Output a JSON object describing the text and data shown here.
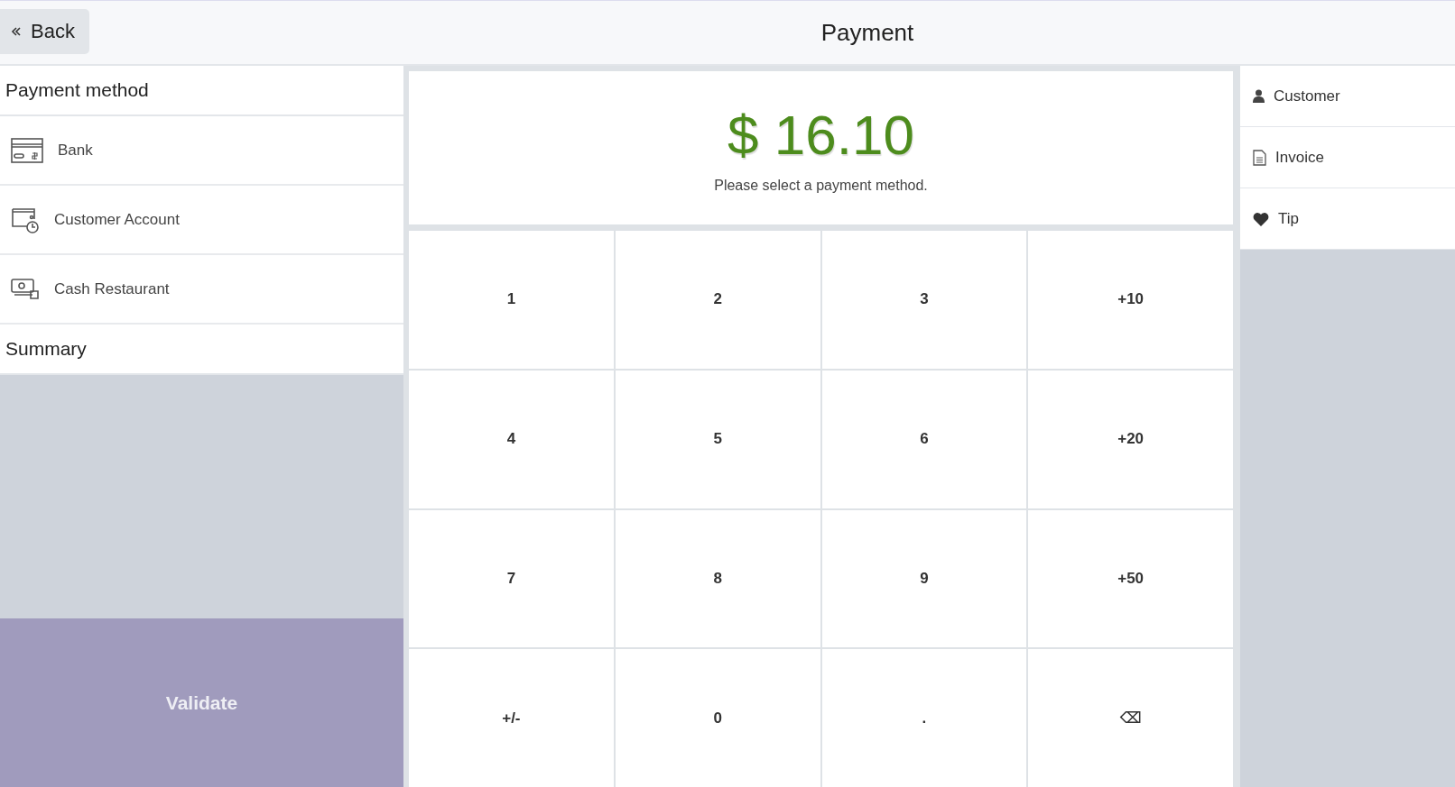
{
  "header": {
    "back_button": "Back",
    "title": "Payment"
  },
  "payment_methods": {
    "title": "Payment method",
    "items": [
      {
        "label": "Bank",
        "kind": "bank"
      },
      {
        "label": "Customer Account",
        "kind": "account"
      },
      {
        "label": "Cash Restaurant",
        "kind": "cash"
      }
    ]
  },
  "summary": {
    "title": "Summary"
  },
  "validate_button": {
    "label": "Validate",
    "disabled": true
  },
  "amount": {
    "total": "$ 16.10",
    "message": "Please select a payment method."
  },
  "numpad": [
    "1",
    "2",
    "3",
    "+10",
    "4",
    "5",
    "6",
    "+20",
    "7",
    "8",
    "9",
    "+50",
    "+/-",
    "0",
    ".",
    "⌫"
  ],
  "side_actions": [
    {
      "label": "Customer",
      "kind": "customer"
    },
    {
      "label": "Invoice",
      "kind": "invoice"
    },
    {
      "label": "Tip",
      "kind": "tip"
    }
  ]
}
